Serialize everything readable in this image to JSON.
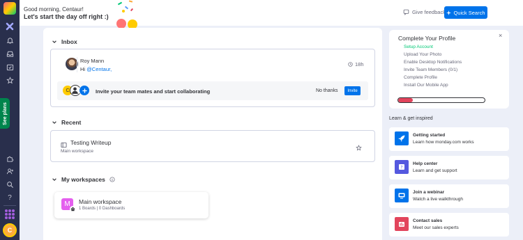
{
  "header": {
    "greeting": "Good morning, Centaur!",
    "tagline": "Let's start the day off right :)",
    "feedback_label": "Give feedback",
    "search_label": "Quick Search"
  },
  "sidebar": {
    "see_plans_label": "See plans",
    "avatar_initial": "C",
    "help_glyph": "?"
  },
  "inbox": {
    "title": "Inbox",
    "sender": "Roy Mann",
    "greeting_word": "Hi",
    "mention": "@Centaur,",
    "time": "18h",
    "invite_text": "Invite your team mates and start collaborating",
    "no_thanks": "No thanks",
    "invite_button": "Invite",
    "invite_avatar_initial": "C"
  },
  "recent": {
    "title": "Recent",
    "item_title": "Testing Writeup",
    "item_workspace": "Main workspace"
  },
  "workspaces": {
    "title": "My workspaces",
    "name": "Main workspace",
    "badge_letter": "M",
    "meta": "1 Boards | 0 Dashboards"
  },
  "profile": {
    "title": "Complete Your Profile",
    "close_glyph": "×",
    "items": [
      {
        "label": "Setup Account",
        "done": true
      },
      {
        "label": "Upload Your Photo",
        "done": false
      },
      {
        "label": "Enable Desktop Notifications",
        "done": false
      },
      {
        "label": "Invite Team Members (0/1)",
        "done": false
      },
      {
        "label": "Complete Profile",
        "done": false
      },
      {
        "label": "Install Our Mobile App",
        "done": false
      }
    ],
    "progress": 0.17
  },
  "learn": {
    "title": "Learn & get inspired",
    "cards": [
      {
        "title": "Getting started",
        "subtitle": "Learn how monday.com works",
        "color": "#0073ea",
        "icon": "rocket-icon"
      },
      {
        "title": "Help center",
        "subtitle": "Learn and get support",
        "color": "#5559df",
        "icon": "help-center-icon"
      },
      {
        "title": "Join a webinar",
        "subtitle": "Watch a live walkthrough",
        "color": "#0073ea",
        "icon": "webinar-icon"
      },
      {
        "title": "Contact sales",
        "subtitle": "Meet our sales experts",
        "color": "#e2445c",
        "icon": "sales-icon"
      }
    ]
  },
  "colors": {
    "rail": "#292f4c",
    "primary": "#0073ea",
    "done": "#00c875",
    "progress": "#e2445c"
  }
}
